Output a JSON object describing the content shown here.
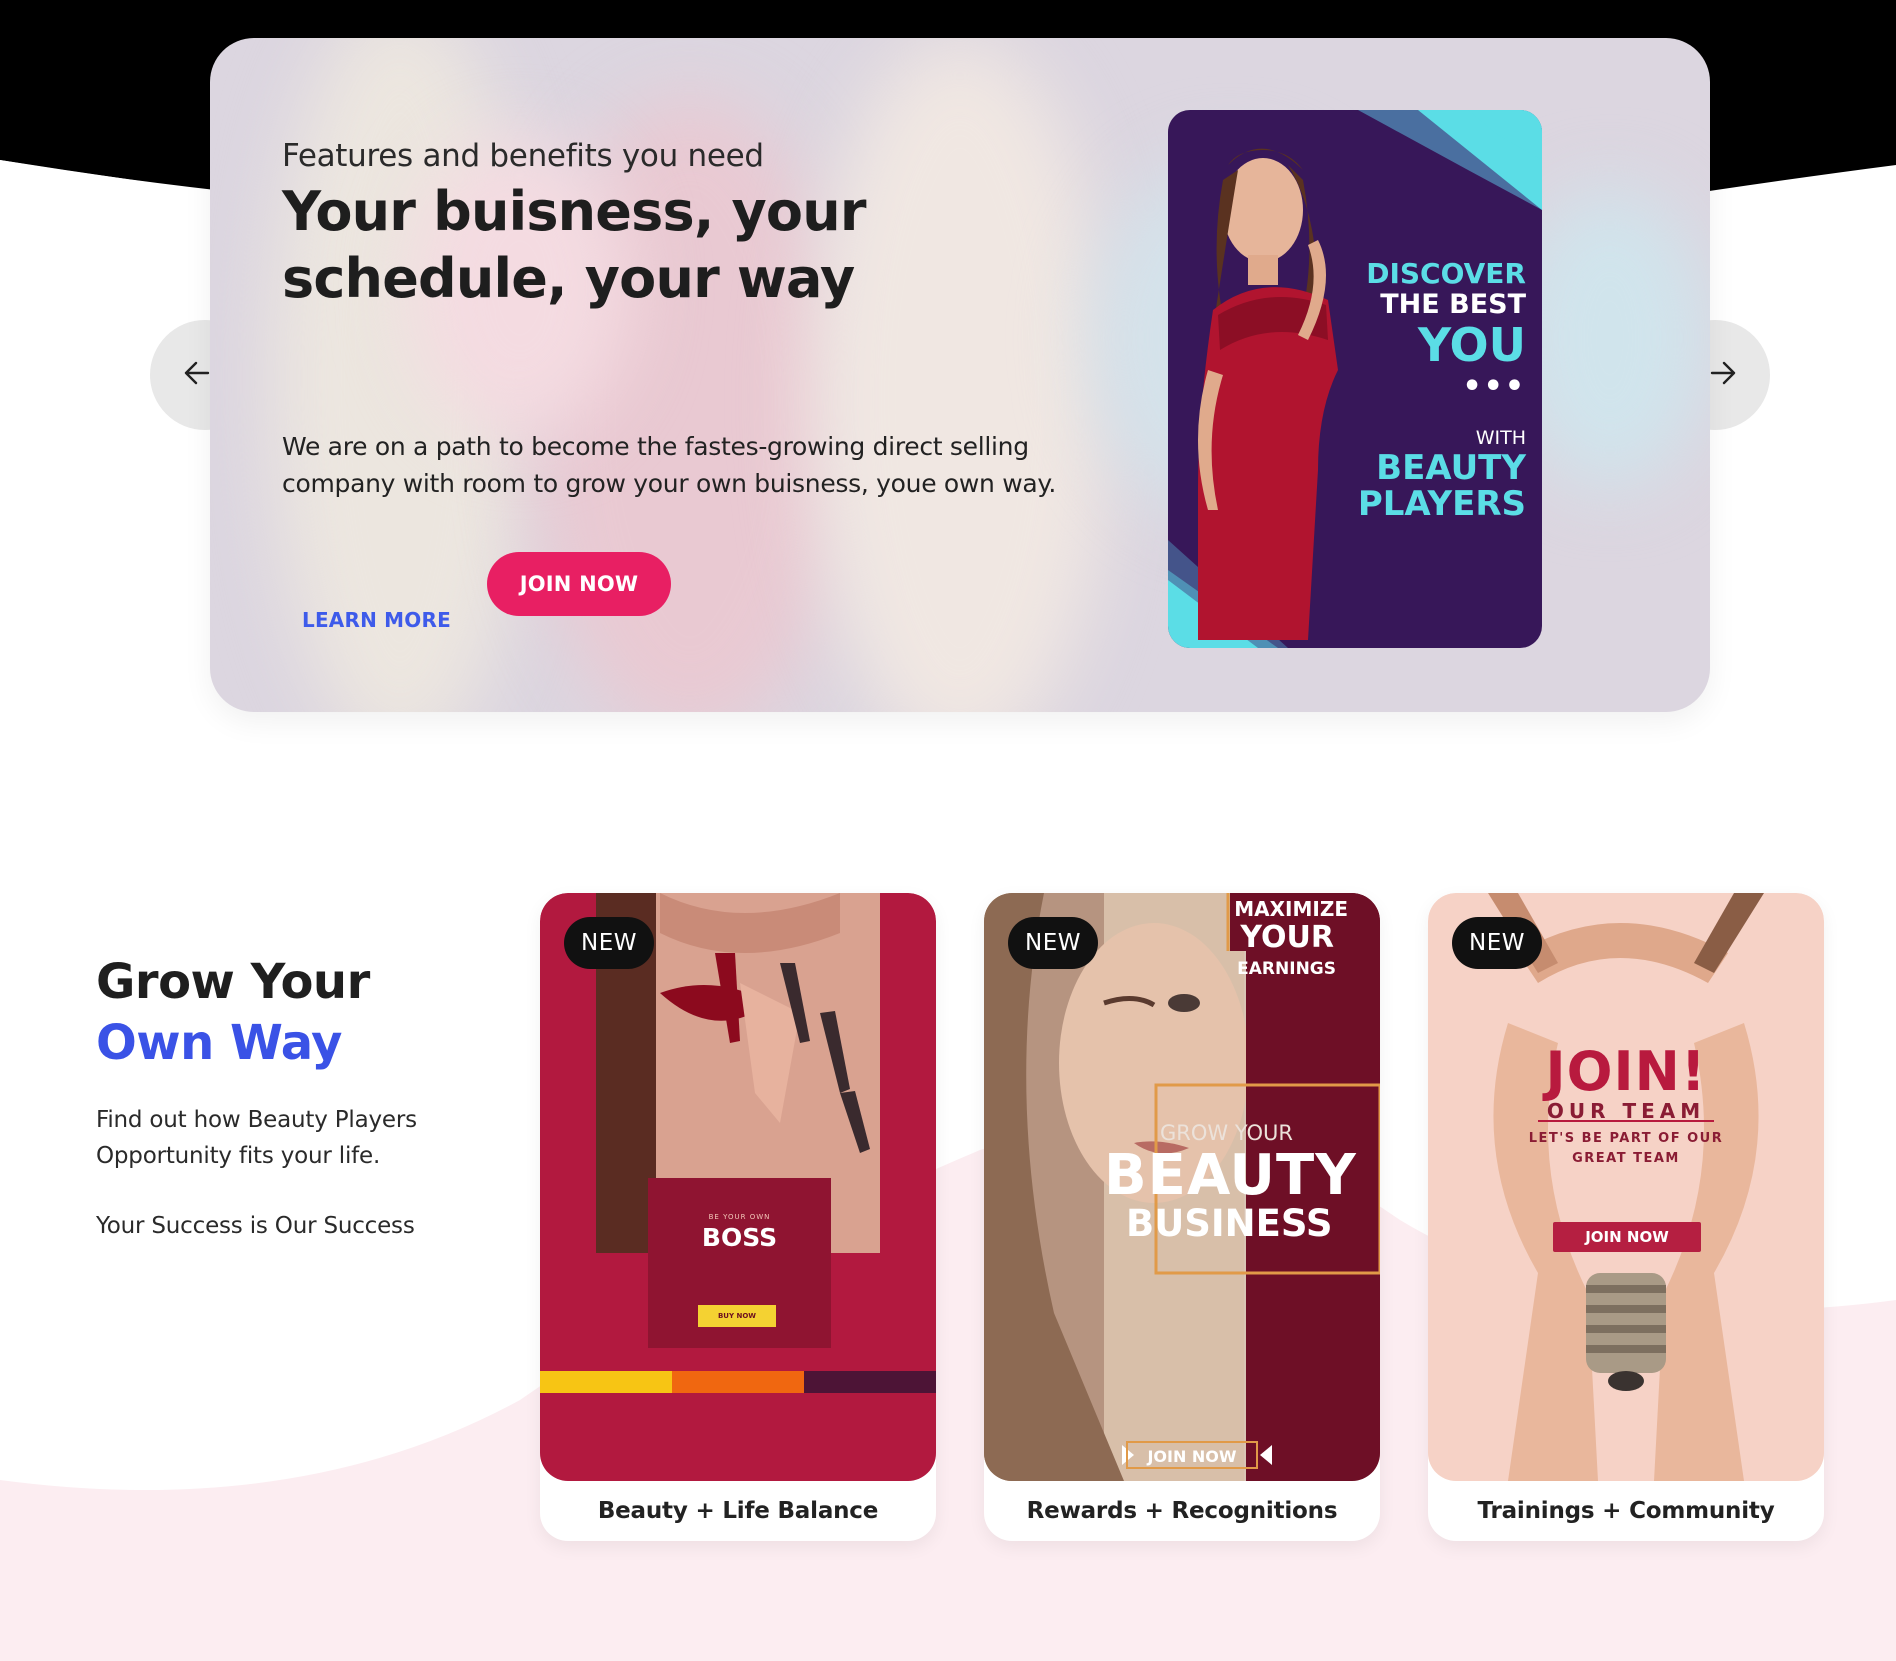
{
  "hero": {
    "eyebrow": "Features and benefits you need",
    "title": "Your buisness, your schedule, your way",
    "description": "We are on a path to become the fastes-growing direct selling company with room to grow your own buisness, youe own way.",
    "learn_more_label": "LEARN MORE",
    "join_now_label": "JOIN NOW",
    "card": {
      "line1": "DISCOVER",
      "line2": "THE BEST",
      "line3": "YOU",
      "dots": "•••",
      "with": "WITH",
      "brand1": "BEAUTY",
      "brand2": "PLAYERS"
    }
  },
  "carousel": {
    "prev_icon": "arrow-left-icon",
    "next_icon": "arrow-right-icon"
  },
  "grow": {
    "title_line1": "Grow Your",
    "title_line2": "Own Way",
    "description": "Find out how Beauty Players Opportunity fits your life.",
    "tagline": "Your Success is Our Success"
  },
  "cards": [
    {
      "badge": "NEW",
      "label": "Beauty + Life Balance",
      "img_text": {
        "own": "BE YOUR OWN",
        "boss": "BOSS",
        "buy": "BUY NOW"
      }
    },
    {
      "badge": "NEW",
      "label": "Rewards + Recognitions",
      "img_text": {
        "max": "MAXIMIZE",
        "your": "YOUR",
        "earn": "EARNINGS",
        "grow": "GROW YOUR",
        "beauty": "BEAUTY",
        "business": "BUSINESS",
        "join": "JOIN NOW"
      }
    },
    {
      "badge": "NEW",
      "label": "Trainings + Community",
      "img_text": {
        "join": "JOIN!",
        "team": "OUR TEAM",
        "part": "LET'S BE PART OF OUR GREAT TEAM",
        "btn": "JOIN NOW"
      }
    }
  ],
  "colors": {
    "accent_pink": "#e81f63",
    "accent_blue": "#3e5bea",
    "hero_card_bg": "#371759",
    "hero_card_cyan": "#5bdde6",
    "card1_bg": "#b2193f",
    "card2_panel": "#6e0f26",
    "card3_bg": "#f6d2c6"
  }
}
